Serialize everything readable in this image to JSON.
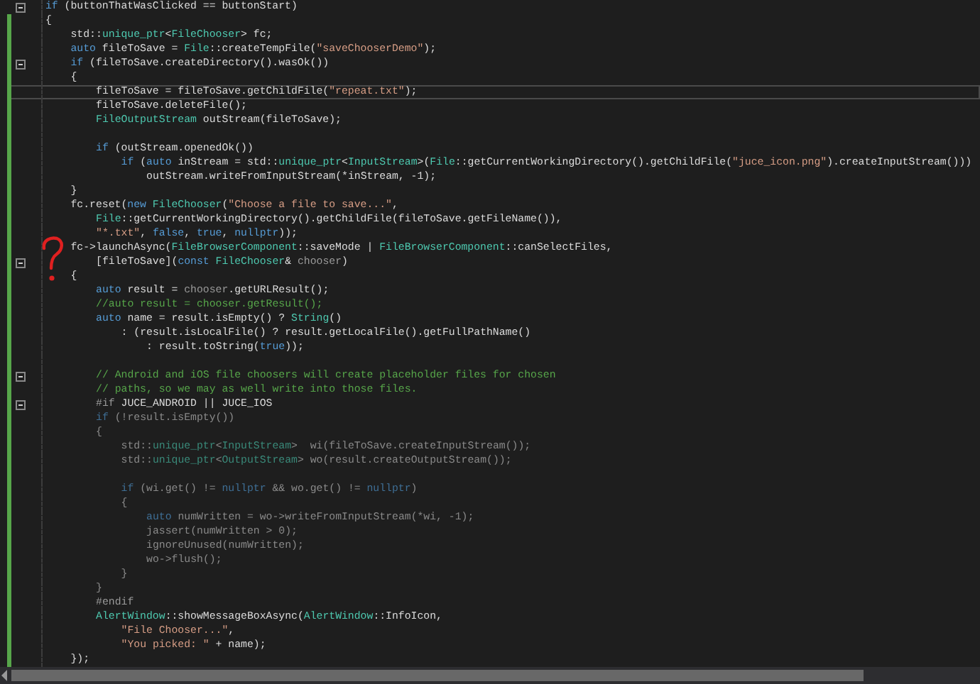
{
  "editor": {
    "lines": [
      {
        "fold": true,
        "current": false,
        "inactive": false,
        "tokens": [
          {
            "kind": "keyword",
            "text": "if"
          },
          {
            "kind": "plain",
            "text": " (buttonThatWasClicked == buttonStart)"
          }
        ]
      },
      {
        "fold": false,
        "current": false,
        "inactive": false,
        "tokens": [
          {
            "kind": "plain",
            "text": "{"
          }
        ]
      },
      {
        "fold": false,
        "current": false,
        "inactive": false,
        "tokens": [
          {
            "kind": "plain",
            "text": "    std::"
          },
          {
            "kind": "type",
            "text": "unique_ptr"
          },
          {
            "kind": "plain",
            "text": "<"
          },
          {
            "kind": "type",
            "text": "FileChooser"
          },
          {
            "kind": "plain",
            "text": "> fc;"
          }
        ]
      },
      {
        "fold": false,
        "current": false,
        "inactive": false,
        "tokens": [
          {
            "kind": "keyword",
            "text": "    auto"
          },
          {
            "kind": "plain",
            "text": " fileToSave = "
          },
          {
            "kind": "type",
            "text": "File"
          },
          {
            "kind": "plain",
            "text": "::createTempFile("
          },
          {
            "kind": "string",
            "text": "\"saveChooserDemo\""
          },
          {
            "kind": "plain",
            "text": ");"
          }
        ]
      },
      {
        "fold": true,
        "current": false,
        "inactive": false,
        "tokens": [
          {
            "kind": "keyword",
            "text": "    if"
          },
          {
            "kind": "plain",
            "text": " (fileToSave.createDirectory().wasOk())"
          }
        ]
      },
      {
        "fold": false,
        "current": false,
        "inactive": false,
        "tokens": [
          {
            "kind": "plain",
            "text": "    {"
          }
        ]
      },
      {
        "fold": false,
        "current": true,
        "inactive": false,
        "tokens": [
          {
            "kind": "plain",
            "text": "        fileToSave = fileToSave.getChildFile("
          },
          {
            "kind": "string",
            "text": "\"repeat.txt\""
          },
          {
            "kind": "plain",
            "text": ");"
          }
        ]
      },
      {
        "fold": false,
        "current": false,
        "inactive": false,
        "tokens": [
          {
            "kind": "plain",
            "text": "        fileToSave.deleteFile();"
          }
        ]
      },
      {
        "fold": false,
        "current": false,
        "inactive": false,
        "tokens": [
          {
            "kind": "type",
            "text": "        FileOutputStream"
          },
          {
            "kind": "plain",
            "text": " outStream(fileToSave);"
          }
        ]
      },
      {
        "fold": false,
        "current": false
      },
      {
        "fold": false,
        "current": false,
        "inactive": false,
        "tokens": [
          {
            "kind": "keyword",
            "text": "        if"
          },
          {
            "kind": "plain",
            "text": " (outStream.openedOk())"
          }
        ]
      },
      {
        "fold": false,
        "current": false,
        "inactive": false,
        "tokens": [
          {
            "kind": "keyword",
            "text": "            if"
          },
          {
            "kind": "plain",
            "text": " ("
          },
          {
            "kind": "keyword",
            "text": "auto"
          },
          {
            "kind": "plain",
            "text": " inStream = std::"
          },
          {
            "kind": "type",
            "text": "unique_ptr"
          },
          {
            "kind": "plain",
            "text": "<"
          },
          {
            "kind": "type",
            "text": "InputStream"
          },
          {
            "kind": "plain",
            "text": ">("
          },
          {
            "kind": "type",
            "text": "File"
          },
          {
            "kind": "plain",
            "text": "::getCurrentWorkingDirectory().getChildFile("
          },
          {
            "kind": "string",
            "text": "\"juce_icon.png\""
          },
          {
            "kind": "plain",
            "text": ").createInputStream()))"
          }
        ]
      },
      {
        "fold": false,
        "current": false,
        "inactive": false,
        "tokens": [
          {
            "kind": "plain",
            "text": "                outStream.writeFromInputStream(*inStream, -1);"
          }
        ]
      },
      {
        "fold": false,
        "current": false,
        "inactive": false,
        "tokens": [
          {
            "kind": "plain",
            "text": "    }"
          }
        ]
      },
      {
        "fold": false,
        "current": false,
        "inactive": false,
        "tokens": [
          {
            "kind": "plain",
            "text": "    fc.reset("
          },
          {
            "kind": "keyword",
            "text": "new"
          },
          {
            "kind": "type",
            "text": " FileChooser"
          },
          {
            "kind": "plain",
            "text": "("
          },
          {
            "kind": "string",
            "text": "\"Choose a file to save...\""
          },
          {
            "kind": "plain",
            "text": ","
          }
        ]
      },
      {
        "fold": false,
        "current": false,
        "inactive": false,
        "tokens": [
          {
            "kind": "type",
            "text": "        File"
          },
          {
            "kind": "plain",
            "text": "::getCurrentWorkingDirectory().getChildFile(fileToSave.getFileName()),"
          }
        ]
      },
      {
        "fold": false,
        "current": false,
        "inactive": false,
        "tokens": [
          {
            "kind": "string",
            "text": "        \"*.txt\""
          },
          {
            "kind": "plain",
            "text": ", "
          },
          {
            "kind": "keyword",
            "text": "false"
          },
          {
            "kind": "plain",
            "text": ", "
          },
          {
            "kind": "keyword",
            "text": "true"
          },
          {
            "kind": "plain",
            "text": ", "
          },
          {
            "kind": "keyword",
            "text": "nullptr"
          },
          {
            "kind": "plain",
            "text": "));"
          }
        ]
      },
      {
        "fold": false,
        "current": false,
        "inactive": false,
        "tokens": [
          {
            "kind": "plain",
            "text": "    fc->launchAsync("
          },
          {
            "kind": "type",
            "text": "FileBrowserComponent"
          },
          {
            "kind": "plain",
            "text": "::saveMode | "
          },
          {
            "kind": "type",
            "text": "FileBrowserComponent"
          },
          {
            "kind": "plain",
            "text": "::canSelectFiles,"
          }
        ]
      },
      {
        "fold": true,
        "current": false,
        "inactive": false,
        "tokens": [
          {
            "kind": "plain",
            "text": "        [fileToSave]("
          },
          {
            "kind": "keyword",
            "text": "const"
          },
          {
            "kind": "type",
            "text": " FileChooser"
          },
          {
            "kind": "plain",
            "text": "& "
          },
          {
            "kind": "parameter",
            "text": "chooser"
          },
          {
            "kind": "plain",
            "text": ")"
          }
        ]
      },
      {
        "fold": false,
        "current": false,
        "inactive": false,
        "tokens": [
          {
            "kind": "plain",
            "text": "    {"
          }
        ]
      },
      {
        "fold": false,
        "current": false,
        "inactive": false,
        "tokens": [
          {
            "kind": "keyword",
            "text": "        auto"
          },
          {
            "kind": "plain",
            "text": " result = "
          },
          {
            "kind": "parameter",
            "text": "chooser"
          },
          {
            "kind": "plain",
            "text": ".getURLResult();"
          }
        ]
      },
      {
        "fold": false,
        "current": false,
        "inactive": false,
        "tokens": [
          {
            "kind": "comment",
            "text": "        //auto result = chooser.getResult();"
          }
        ]
      },
      {
        "fold": false,
        "current": false,
        "inactive": false,
        "tokens": [
          {
            "kind": "keyword",
            "text": "        auto"
          },
          {
            "kind": "plain",
            "text": " name = result.isEmpty() ? "
          },
          {
            "kind": "type",
            "text": "String"
          },
          {
            "kind": "plain",
            "text": "()"
          }
        ]
      },
      {
        "fold": false,
        "current": false,
        "inactive": false,
        "tokens": [
          {
            "kind": "plain",
            "text": "            : (result.isLocalFile() ? result.getLocalFile().getFullPathName()"
          }
        ]
      },
      {
        "fold": false,
        "current": false,
        "inactive": false,
        "tokens": [
          {
            "kind": "plain",
            "text": "                : result.toString("
          },
          {
            "kind": "keyword",
            "text": "true"
          },
          {
            "kind": "plain",
            "text": "));"
          }
        ]
      },
      {
        "fold": false,
        "current": false
      },
      {
        "fold": true,
        "current": false,
        "inactive": false,
        "tokens": [
          {
            "kind": "comment",
            "text": "        // Android and iOS file choosers will create placeholder files for chosen"
          }
        ]
      },
      {
        "fold": false,
        "current": false,
        "inactive": false,
        "tokens": [
          {
            "kind": "comment",
            "text": "        // paths, so we may as well write into those files."
          }
        ]
      },
      {
        "fold": true,
        "current": false,
        "inactive": false,
        "tokens": [
          {
            "kind": "preprocessor",
            "text": "        #if"
          },
          {
            "kind": "plain",
            "text": " JUCE_ANDROID || JUCE_IOS"
          }
        ]
      },
      {
        "fold": false,
        "current": false,
        "inactive": true,
        "tokens": [
          {
            "kind": "keyword",
            "text": "        if"
          },
          {
            "kind": "plain",
            "text": " (!result.isEmpty())"
          }
        ]
      },
      {
        "fold": false,
        "current": false,
        "inactive": true,
        "tokens": [
          {
            "kind": "plain",
            "text": "        {"
          }
        ]
      },
      {
        "fold": false,
        "current": false,
        "inactive": true,
        "tokens": [
          {
            "kind": "plain",
            "text": "            std::"
          },
          {
            "kind": "type",
            "text": "unique_ptr"
          },
          {
            "kind": "plain",
            "text": "<"
          },
          {
            "kind": "type",
            "text": "InputStream"
          },
          {
            "kind": "plain",
            "text": ">  wi(fileToSave.createInputStream());"
          }
        ]
      },
      {
        "fold": false,
        "current": false,
        "inactive": true,
        "tokens": [
          {
            "kind": "plain",
            "text": "            std::"
          },
          {
            "kind": "type",
            "text": "unique_ptr"
          },
          {
            "kind": "plain",
            "text": "<"
          },
          {
            "kind": "type",
            "text": "OutputStream"
          },
          {
            "kind": "plain",
            "text": "> wo(result.createOutputStream());"
          }
        ]
      },
      {
        "fold": false,
        "current": false
      },
      {
        "fold": false,
        "current": false,
        "inactive": true,
        "tokens": [
          {
            "kind": "keyword",
            "text": "            if"
          },
          {
            "kind": "plain",
            "text": " (wi.get() != "
          },
          {
            "kind": "keyword",
            "text": "nullptr"
          },
          {
            "kind": "plain",
            "text": " && wo.get() != "
          },
          {
            "kind": "keyword",
            "text": "nullptr"
          },
          {
            "kind": "plain",
            "text": ")"
          }
        ]
      },
      {
        "fold": false,
        "current": false,
        "inactive": true,
        "tokens": [
          {
            "kind": "plain",
            "text": "            {"
          }
        ]
      },
      {
        "fold": false,
        "current": false,
        "inactive": true,
        "tokens": [
          {
            "kind": "keyword",
            "text": "                auto"
          },
          {
            "kind": "plain",
            "text": " numWritten = wo->writeFromInputStream(*wi, -1);"
          }
        ]
      },
      {
        "fold": false,
        "current": false,
        "inactive": true,
        "tokens": [
          {
            "kind": "plain",
            "text": "                jassert(numWritten > 0);"
          }
        ]
      },
      {
        "fold": false,
        "current": false,
        "inactive": true,
        "tokens": [
          {
            "kind": "plain",
            "text": "                ignoreUnused(numWritten);"
          }
        ]
      },
      {
        "fold": false,
        "current": false,
        "inactive": true,
        "tokens": [
          {
            "kind": "plain",
            "text": "                wo->flush();"
          }
        ]
      },
      {
        "fold": false,
        "current": false,
        "inactive": true,
        "tokens": [
          {
            "kind": "plain",
            "text": "            }"
          }
        ]
      },
      {
        "fold": false,
        "current": false,
        "inactive": true,
        "tokens": [
          {
            "kind": "plain",
            "text": "        }"
          }
        ]
      },
      {
        "fold": false,
        "current": false,
        "inactive": false,
        "tokens": [
          {
            "kind": "preprocessor",
            "text": "        #endif"
          }
        ]
      },
      {
        "fold": false,
        "current": false,
        "inactive": false,
        "tokens": [
          {
            "kind": "type",
            "text": "        AlertWindow"
          },
          {
            "kind": "plain",
            "text": "::showMessageBoxAsync("
          },
          {
            "kind": "type",
            "text": "AlertWindow"
          },
          {
            "kind": "plain",
            "text": "::InfoIcon,"
          }
        ]
      },
      {
        "fold": false,
        "current": false,
        "inactive": false,
        "tokens": [
          {
            "kind": "string",
            "text": "            \"File Chooser...\""
          },
          {
            "kind": "plain",
            "text": ","
          }
        ]
      },
      {
        "fold": false,
        "current": false,
        "inactive": false,
        "tokens": [
          {
            "kind": "string",
            "text": "            \"You picked: \""
          },
          {
            "kind": "plain",
            "text": " + name);"
          }
        ]
      },
      {
        "fold": false,
        "current": false,
        "inactive": false,
        "tokens": [
          {
            "kind": "plain",
            "text": "    });"
          }
        ]
      }
    ]
  }
}
